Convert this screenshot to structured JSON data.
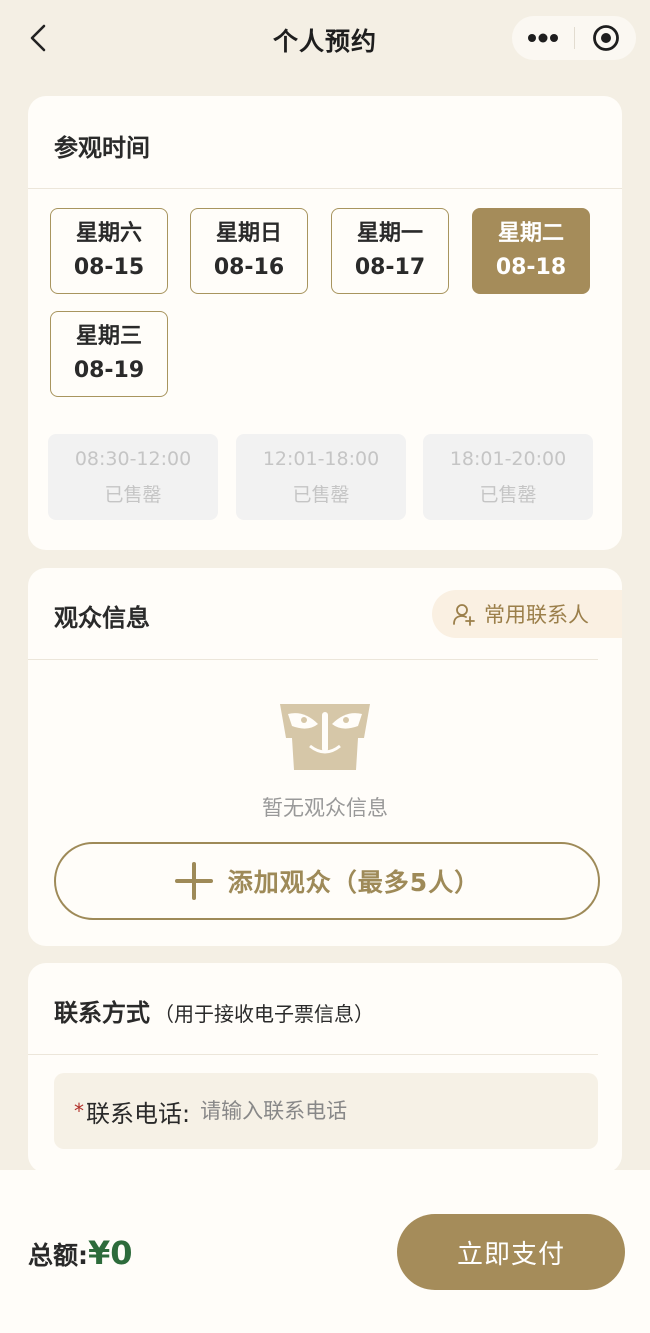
{
  "nav": {
    "title": "个人预约",
    "back_icon": "chevron-left-icon",
    "more_icon": "more-dots-icon",
    "close_icon": "target-close-icon"
  },
  "visit": {
    "title": "参观时间",
    "dates": [
      {
        "weekday": "星期六",
        "date": "08-15",
        "selected": false
      },
      {
        "weekday": "星期日",
        "date": "08-16",
        "selected": false
      },
      {
        "weekday": "星期一",
        "date": "08-17",
        "selected": false
      },
      {
        "weekday": "星期二",
        "date": "08-18",
        "selected": true
      },
      {
        "weekday": "星期三",
        "date": "08-19",
        "selected": false
      }
    ],
    "slots": [
      {
        "time": "08:30-12:00",
        "status": "已售罄"
      },
      {
        "time": "12:01-18:00",
        "status": "已售罄"
      },
      {
        "time": "18:01-20:00",
        "status": "已售罄"
      }
    ]
  },
  "audience": {
    "title": "观众信息",
    "contacts_label": "常用联系人",
    "contacts_icon": "add-user-icon",
    "empty_icon": "bronze-mask-icon",
    "empty_text": "暂无观众信息",
    "add_icon": "plus-icon",
    "add_label": "添加观众（最多5人）"
  },
  "contact": {
    "title": "联系方式",
    "subtitle": "（用于接收电子票信息）",
    "required_mark": "*",
    "phone_label": "联系电话:",
    "phone_placeholder": "请输入联系电话",
    "phone_value": ""
  },
  "footer": {
    "total_label": "总额:",
    "total_amount": "¥0",
    "pay_label": "立即支付"
  },
  "colors": {
    "accent": "#a58c5a",
    "background": "#f4efe4",
    "amount": "#2d6b3b",
    "required": "#b0302a"
  }
}
